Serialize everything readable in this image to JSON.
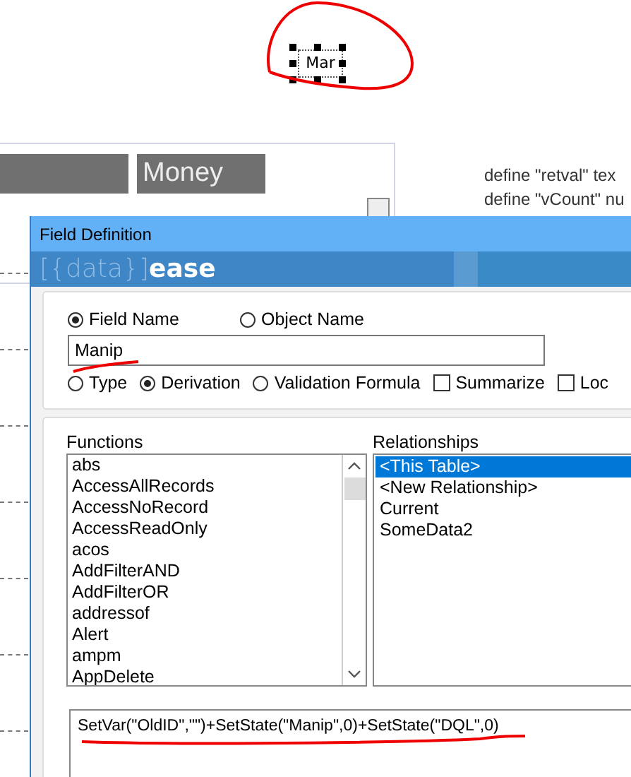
{
  "canvas_label": {
    "text": "Mar",
    "selected": true
  },
  "header_bars": [
    {
      "label": "Money"
    }
  ],
  "script_lines": [
    "define \"retval\" tex",
    "define \"vCount\" nu"
  ],
  "dialog": {
    "title": "Field Definition",
    "logo": {
      "light": "[{data}]",
      "bold": "ease"
    },
    "name_options": [
      {
        "label": "Field Name",
        "selected": true
      },
      {
        "label": "Object Name",
        "selected": false
      }
    ],
    "name_value": "Manip",
    "mode_options": [
      {
        "label": "Type",
        "selected": false
      },
      {
        "label": "Derivation",
        "selected": true
      },
      {
        "label": "Validation Formula",
        "selected": false
      }
    ],
    "checkboxes": [
      {
        "label": "Summarize",
        "checked": false
      },
      {
        "label": "Loc",
        "checked": false
      }
    ],
    "functions": {
      "label": "Functions",
      "items": [
        "abs",
        "AccessAllRecords",
        "AccessNoRecord",
        "AccessReadOnly",
        "acos",
        "AddFilterAND",
        "AddFilterOR",
        "addressof",
        "Alert",
        "ampm",
        "AppDelete"
      ]
    },
    "relationships": {
      "label": "Relationships",
      "items": [
        {
          "label": "<This Table>",
          "selected": true
        },
        {
          "label": "<New Relationship>",
          "selected": false
        },
        {
          "label": "Current",
          "selected": false
        },
        {
          "label": "SomeData2",
          "selected": false
        }
      ]
    },
    "formula": "SetVar(\"OldID\",\"\")+SetState(\"Manip\",0)+SetState(\"DQL\",0)"
  }
}
